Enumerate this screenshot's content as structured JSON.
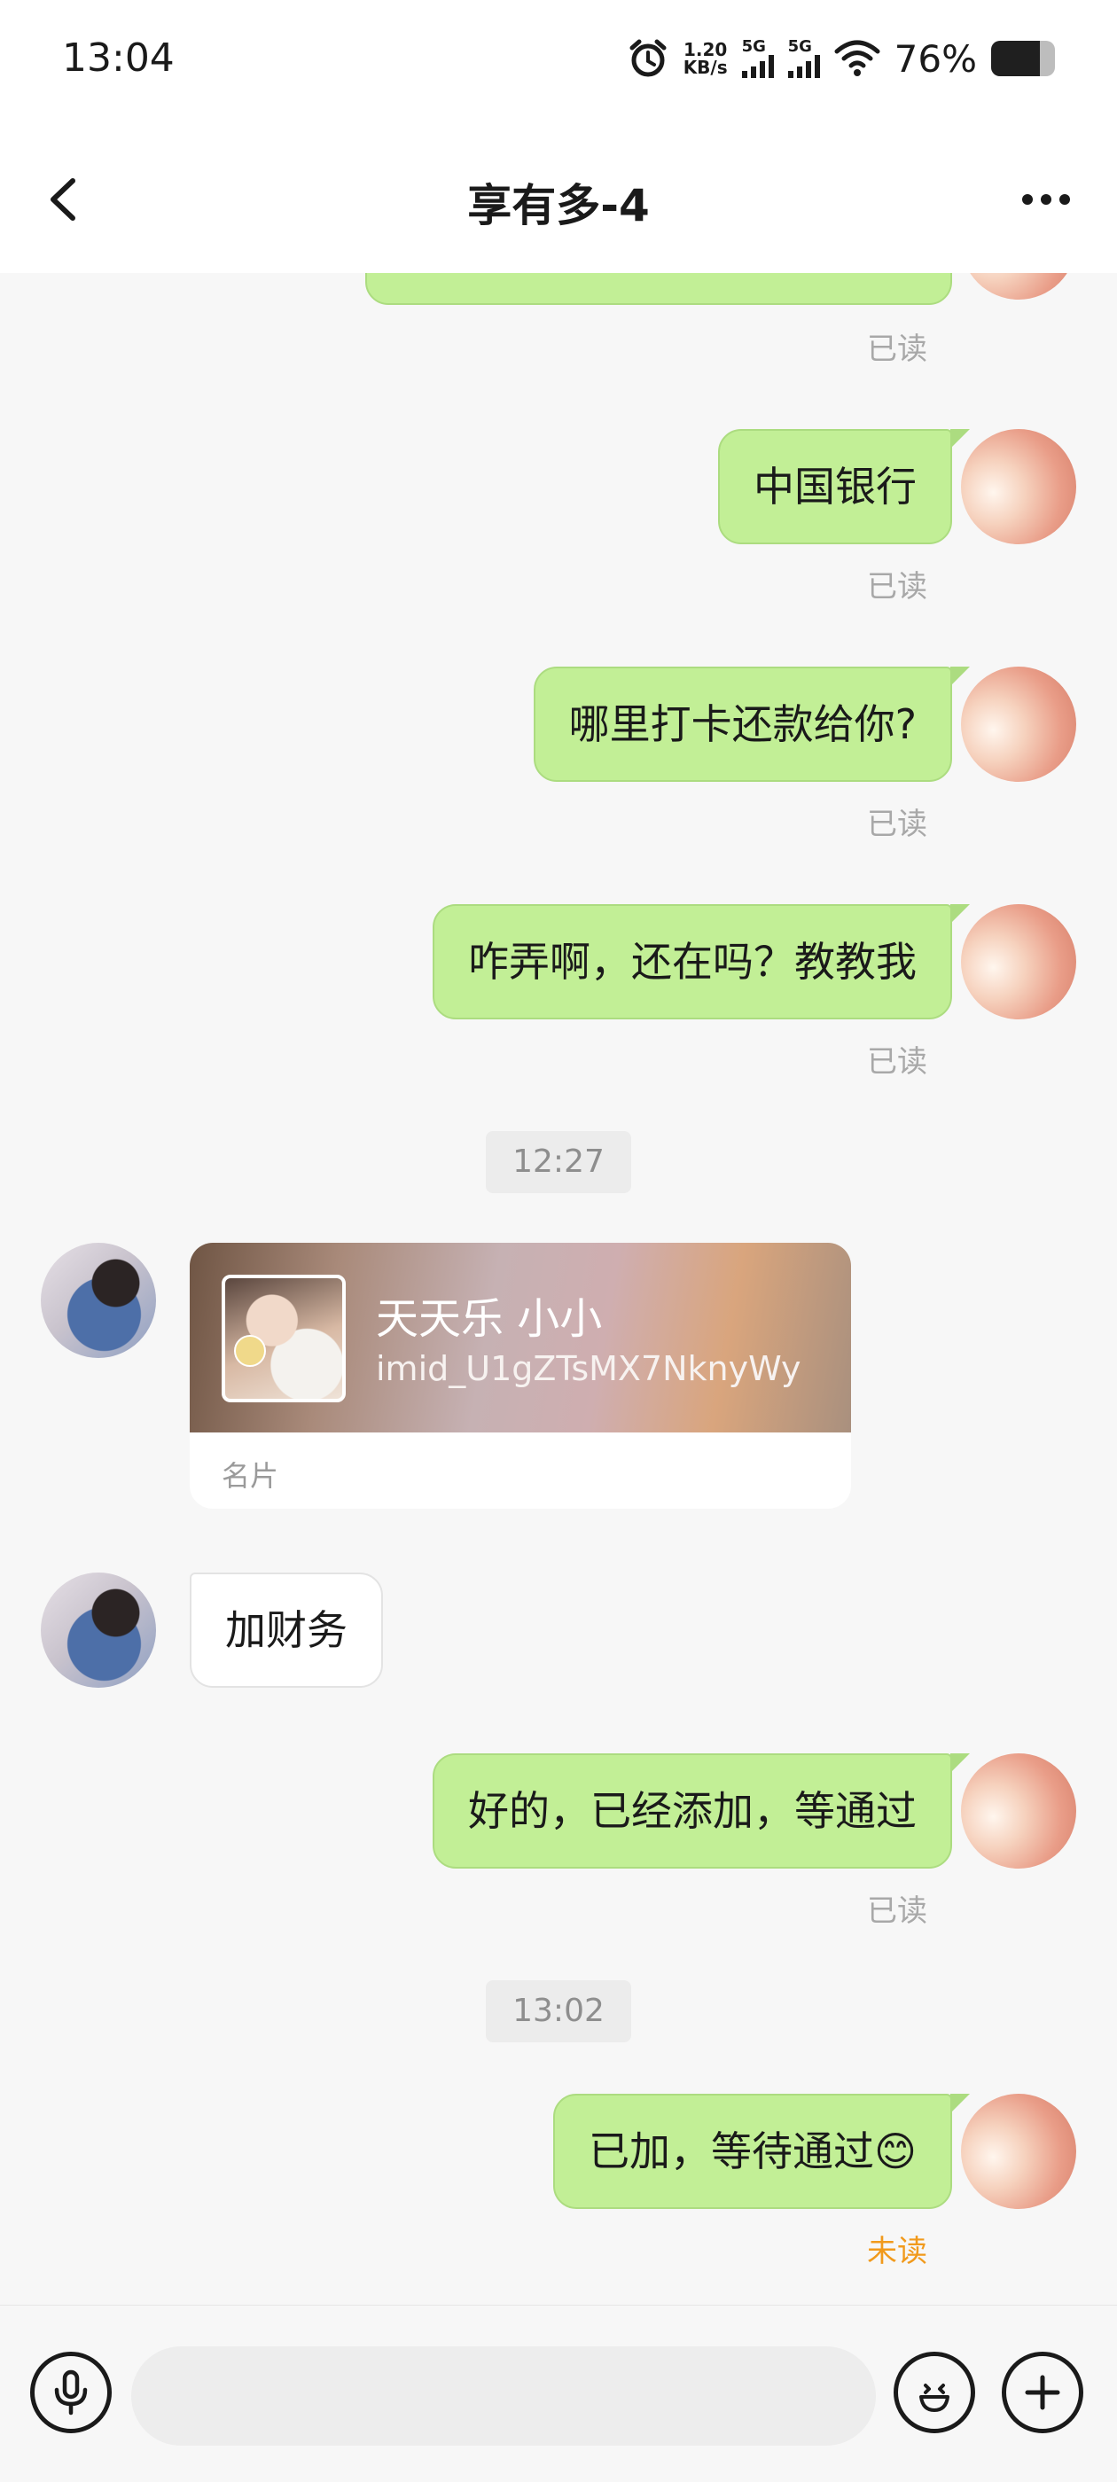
{
  "status_bar": {
    "time": "13:04",
    "net_speed_value": "1.20",
    "net_speed_unit": "KB/s",
    "sim1_label": "5G",
    "sim2_label": "5G",
    "battery_percent": "76%",
    "battery_level": 0.76,
    "icons": [
      "alarm-icon",
      "signal-icon",
      "wifi-icon",
      "battery-icon"
    ]
  },
  "header": {
    "back_icon": "chevron-left-icon",
    "title": "享有多-4",
    "more_icon": "more-horizontal-icon"
  },
  "messages": [
    {
      "direction": "outgoing",
      "text": "",
      "receipt": "已读"
    },
    {
      "direction": "outgoing",
      "text": "中国银行",
      "receipt": "已读"
    },
    {
      "direction": "outgoing",
      "text": "哪里打卡还款给你?",
      "receipt": "已读"
    },
    {
      "direction": "outgoing",
      "text": "咋弄啊，还在吗？教教我",
      "receipt": "已读"
    },
    {
      "type": "timestamp",
      "text": "12:27"
    },
    {
      "direction": "incoming",
      "type": "contact_card",
      "name": "天天乐 小小",
      "id": "imid_U1gZTsMX7NknyWy",
      "label": "名片"
    },
    {
      "direction": "incoming",
      "text": "加财务"
    },
    {
      "direction": "outgoing",
      "text": "好的，已经添加，等通过",
      "receipt": "已读"
    },
    {
      "type": "timestamp",
      "text": "13:02"
    },
    {
      "direction": "outgoing",
      "text": "已加，等待通过",
      "emoji": "😊",
      "receipt": "未读"
    }
  ],
  "input_bar": {
    "voice_icon": "microphone-icon",
    "placeholder": "",
    "emoji_icon": "smiley-icon",
    "add_icon": "plus-icon"
  },
  "colors": {
    "outgoing_bubble": "#c2ef96",
    "incoming_bubble": "#ffffff",
    "unread_receipt": "#f19a1c",
    "read_receipt": "#a8a8a8",
    "background": "#f7f7f7"
  }
}
